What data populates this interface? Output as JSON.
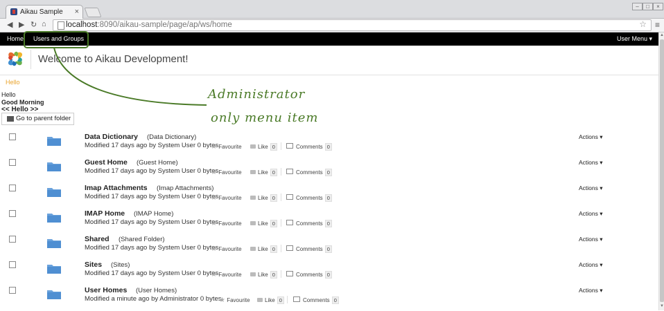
{
  "browser": {
    "tab_title": "Aikau Sample Client",
    "tab_close": "×",
    "url_host": "localhost",
    "url_path": ":8090/aikau-sample/page/ap/ws/home"
  },
  "appbar": {
    "home": "Home",
    "users_groups": "Users and Groups",
    "user_menu": "User Menu ▾"
  },
  "header": {
    "title": "Welcome to Aikau Development!"
  },
  "content": {
    "hello_link": "Hello",
    "hello_text": "Hello",
    "good_morning": "Good Morning",
    "hello_nav": "<< Hello >>",
    "parent_folder": "Go to parent folder"
  },
  "labels": {
    "favourite": "Favourite",
    "like": "Like",
    "comments": "Comments",
    "actions": "Actions ▾"
  },
  "rows": [
    {
      "name": "Data Dictionary",
      "display": "(Data Dictionary)",
      "meta": "Modified 17 days ago by System User 0 bytes",
      "likes": "0",
      "comments": "0"
    },
    {
      "name": "Guest Home",
      "display": "(Guest Home)",
      "meta": "Modified 17 days ago by System User 0 bytes",
      "likes": "0",
      "comments": "0"
    },
    {
      "name": "Imap Attachments",
      "display": "(Imap Attachments)",
      "meta": "Modified 17 days ago by System User 0 bytes",
      "likes": "0",
      "comments": "0"
    },
    {
      "name": "IMAP Home",
      "display": "(IMAP Home)",
      "meta": "Modified 17 days ago by System User 0 bytes",
      "likes": "0",
      "comments": "0"
    },
    {
      "name": "Shared",
      "display": "(Shared Folder)",
      "meta": "Modified 17 days ago by System User 0 bytes",
      "likes": "0",
      "comments": "0"
    },
    {
      "name": "Sites",
      "display": "(Sites)",
      "meta": "Modified 17 days ago by System User 0 bytes",
      "likes": "0",
      "comments": "0"
    },
    {
      "name": "User Homes",
      "display": "(User Homes)",
      "meta": "Modified a minute ago by Administrator 0 bytes",
      "likes": "0",
      "comments": "0"
    }
  ],
  "annotation": {
    "line1": "Administrator",
    "line2": "only menu item",
    "color": "#4a7a27"
  },
  "colors": {
    "appbar_bg": "#000000",
    "hello_link": "#e9a32b",
    "folder": "#6aa2dc"
  }
}
